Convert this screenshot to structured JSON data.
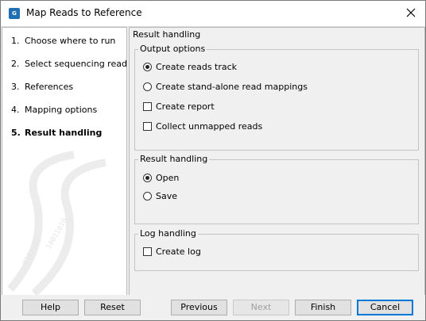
{
  "window": {
    "title": "Map Reads to Reference",
    "app_icon_text": "G",
    "close_icon": "close-icon"
  },
  "steps": [
    {
      "num": "1.",
      "label": "Choose where to run",
      "active": false
    },
    {
      "num": "2.",
      "label": "Select sequencing reads",
      "active": false
    },
    {
      "num": "3.",
      "label": "References",
      "active": false
    },
    {
      "num": "4.",
      "label": "Mapping options",
      "active": false
    },
    {
      "num": "5.",
      "label": "Result handling",
      "active": true
    }
  ],
  "panel": {
    "title": "Result handling",
    "output_options": {
      "legend": "Output options",
      "create_reads_track": {
        "label": "Create reads track",
        "checked": true
      },
      "create_standalone": {
        "label": "Create stand-alone read mappings",
        "checked": false
      },
      "create_report": {
        "label": "Create report",
        "checked": false
      },
      "collect_unmapped": {
        "label": "Collect unmapped reads",
        "checked": false
      }
    },
    "result_handling": {
      "legend": "Result handling",
      "open": {
        "label": "Open",
        "checked": true
      },
      "save": {
        "label": "Save",
        "checked": false
      }
    },
    "log_handling": {
      "legend": "Log handling",
      "create_log": {
        "label": "Create log",
        "checked": false
      }
    }
  },
  "footer": {
    "help": "Help",
    "reset": "Reset",
    "previous": "Previous",
    "next": "Next",
    "finish": "Finish",
    "cancel": "Cancel"
  }
}
